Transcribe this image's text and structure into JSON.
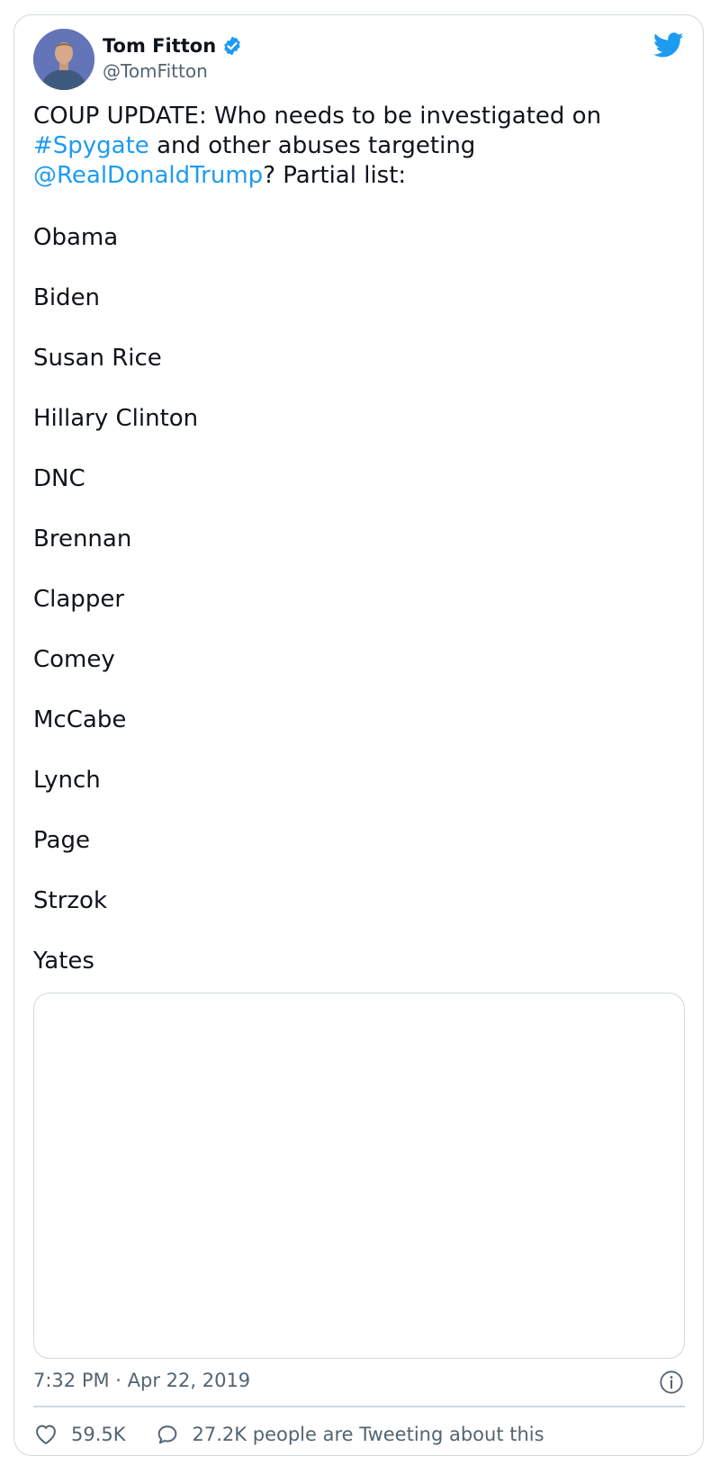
{
  "tweet": {
    "author": {
      "display_name": "Tom Fitton",
      "handle": "@TomFitton",
      "verified": true
    },
    "text_parts": {
      "lead": "COUP UPDATE: Who needs to be investigated on ",
      "hashtag": "#Spygate",
      "middle": " and other abuses targeting ",
      "mention": "@RealDonaldTrump",
      "tail": "? Partial list:"
    },
    "list": [
      "Obama",
      "Biden",
      "Susan Rice",
      "Hillary Clinton",
      "DNC",
      "Brennan",
      "Clapper",
      "Comey",
      "McCabe",
      "Lynch",
      "Page",
      "Strzok",
      "Yates"
    ],
    "timestamp": "7:32 PM · Apr 22, 2019",
    "likes": "59.5K",
    "conversation": "27.2K people are Tweeting about this"
  },
  "icons": {
    "brand": "bird-icon",
    "verified": "verified-badge-icon",
    "info": "info-icon",
    "like": "heart-icon",
    "reply": "speech-bubble-icon"
  },
  "colors": {
    "link": "#1d9bf0",
    "text": "#0f1419",
    "secondary": "#536471",
    "border": "#cfd9de"
  }
}
